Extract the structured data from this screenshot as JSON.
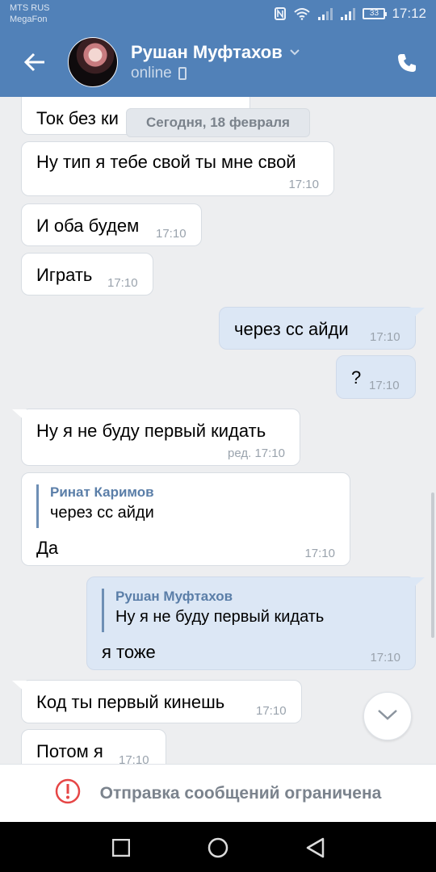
{
  "status_bar": {
    "carrier_1": "MTS RUS",
    "carrier_2": "MegaFon",
    "battery": "33",
    "time": "17:12"
  },
  "header": {
    "contact_name": "Рушан Муфтахов",
    "presence": "online",
    "icons": [
      "back-arrow-icon",
      "chevron-down-icon",
      "mobile-phone-icon",
      "phone-call-icon"
    ]
  },
  "chat": {
    "date_chip": "Сегодня, 18 февраля",
    "messages": [
      {
        "text": "Ток без ки",
        "time": ""
      },
      {
        "text": "Ну тип я тебе свой ты мне свой",
        "time": "17:10"
      },
      {
        "text": "И оба будем",
        "time": "17:10"
      },
      {
        "text": "Играть",
        "time": "17:10"
      },
      {
        "text": "через сс айди",
        "time": "17:10"
      },
      {
        "text": "?",
        "time": "17:10"
      },
      {
        "text": "Ну я не буду первый кидать",
        "time": "ред. 17:10"
      },
      {
        "reply_name": "Ринат Каримов",
        "reply_text": "через сс айди",
        "text": "Да",
        "time": "17:10"
      },
      {
        "reply_name": "Рушан Муфтахов",
        "reply_text": "Ну я не буду первый кидать",
        "text": "я тоже",
        "time": "17:10"
      },
      {
        "text": "Код ты первый кинешь",
        "time": "17:10"
      },
      {
        "text": "Потом я",
        "time": "17:10"
      }
    ]
  },
  "footer": {
    "restriction_text": "Отправка сообщений ограничена"
  },
  "colors": {
    "header": "#5181b8",
    "outgoing": "#dce7f5",
    "incoming": "#ffffff",
    "background": "#edeef0",
    "alert": "#e64646"
  }
}
